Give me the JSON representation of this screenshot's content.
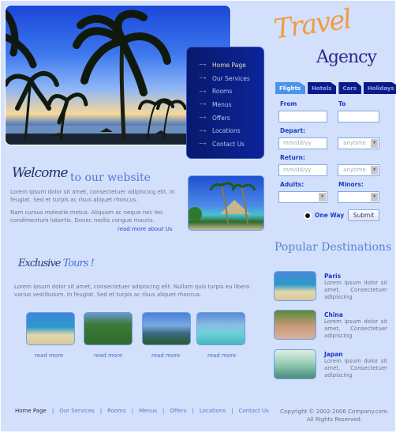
{
  "logo": {
    "line1": "Travel",
    "line2": "Agency"
  },
  "nav": {
    "items": [
      {
        "label": "Home Page",
        "active": true
      },
      {
        "label": "Our Services"
      },
      {
        "label": "Rooms"
      },
      {
        "label": "Menus"
      },
      {
        "label": "Offers"
      },
      {
        "label": "Locations"
      },
      {
        "label": "Contact Us"
      }
    ],
    "arrow": "···➝"
  },
  "booking": {
    "tabs": [
      {
        "label": "Flights",
        "active": true
      },
      {
        "label": "Hotels"
      },
      {
        "label": "Cars"
      },
      {
        "label": "Holidays"
      }
    ],
    "from_label": "From",
    "from_value": "",
    "to_label": "To",
    "to_value": "",
    "depart_label": "Depart:",
    "depart_placeholder": "mm/dd/yy",
    "depart_time": "anytime",
    "return_label": "Return:",
    "return_placeholder": "mm/dd/yy",
    "return_time": "anytime",
    "adults_label": "Adults:",
    "adults_value": "",
    "minors_label": "Minors:",
    "minors_value": "",
    "oneway_label": "One Way",
    "submit_label": "Submit",
    "dropdown_glyph": "▼"
  },
  "welcome": {
    "title": "Welcome",
    "subtitle": "to our website",
    "para1": "Lorem ipsum dolor sit amet, consectetuer adipiscing elit. In feugiat. Sed et turpis ac risus aliquet rhoncus.",
    "para2": "Nam cursus molestie metus. Aliquam ac neque nec leo condimentum lobortis. Donec mollis congue mauris.",
    "read_more": "read more about Us"
  },
  "tours": {
    "title_a": "Exclusive",
    "title_b": "Tours !",
    "text": "Lorem ipsum dolor sit amet, consectetuer adipiscing elit. Nullam quis turpis eu libero varius vestibulum. In feugiat. Sed et turpis ac risus aliquet rhoncus.",
    "items": [
      {
        "read_more": "read more"
      },
      {
        "read_more": "read more"
      },
      {
        "read_more": "read more"
      },
      {
        "read_more": "read more"
      }
    ]
  },
  "popular": {
    "title_a": "Popular",
    "title_b": "Destinations",
    "items": [
      {
        "name": "Paris",
        "text": "Lorem ipsum dolor sit amet,  Consectetuer adipiscing"
      },
      {
        "name": "China",
        "text": "Lorem ipsum dolor sit amet,  Consectetuer adipiscing"
      },
      {
        "name": "Japan",
        "text": "Lorem ipsum dolor sit amet,  Consectetuer adipiscing"
      }
    ]
  },
  "footer": {
    "links": [
      "Home Page",
      "Our Services",
      "Rooms",
      "Menus",
      "Offers",
      "Locations",
      "Contact Us"
    ],
    "separator": "|",
    "copyright_line1": "Copyright © 2002-2006 Company.com.",
    "copyright_line2": "All Rights Reserved."
  }
}
